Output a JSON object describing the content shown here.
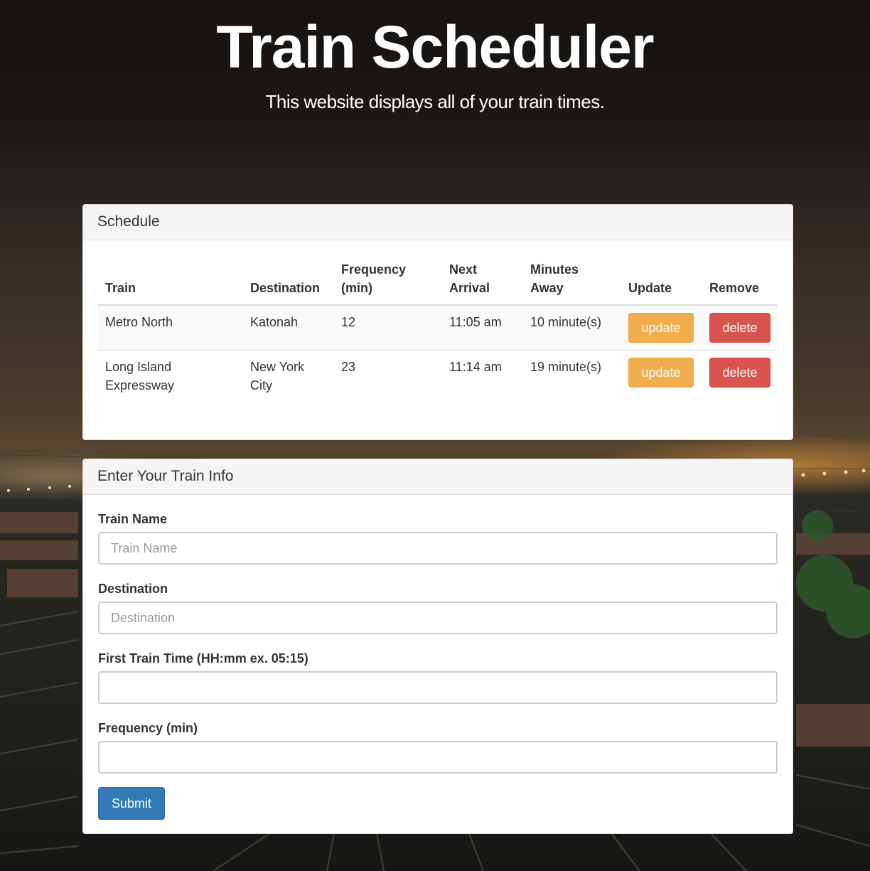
{
  "header": {
    "title": "Train Scheduler",
    "subtitle": "This website displays all of your train times."
  },
  "schedule": {
    "panel_title": "Schedule",
    "columns": [
      "Train",
      "Destination",
      "Frequency (min)",
      "Next Arrival",
      "Minutes Away",
      "Update",
      "Remove"
    ],
    "rows": [
      {
        "train": "Metro North",
        "destination": "Katonah",
        "frequency": "12",
        "next_arrival": "11:05 am",
        "minutes_away": "10 minute(s)",
        "update_label": "update",
        "delete_label": "delete"
      },
      {
        "train": "Long Island Expressway",
        "destination": "New York City",
        "frequency": "23",
        "next_arrival": "11:14 am",
        "minutes_away": "19 minute(s)",
        "update_label": "update",
        "delete_label": "delete"
      }
    ]
  },
  "form": {
    "panel_title": "Enter Your Train Info",
    "train_name": {
      "label": "Train Name",
      "placeholder": "Train Name",
      "value": ""
    },
    "destination": {
      "label": "Destination",
      "placeholder": "Destination",
      "value": ""
    },
    "first_time": {
      "label": "First Train Time (HH:mm ex. 05:15)",
      "placeholder": "",
      "value": ""
    },
    "frequency": {
      "label": "Frequency (min)",
      "placeholder": "",
      "value": ""
    },
    "submit_label": "Submit"
  },
  "colors": {
    "warning": "#f0ad4e",
    "danger": "#d9534f",
    "primary": "#337ab7",
    "panel_heading": "#f5f5f5"
  }
}
